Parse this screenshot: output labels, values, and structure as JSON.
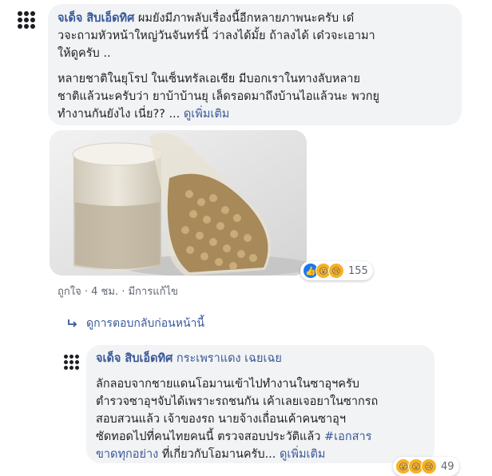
{
  "comment1": {
    "author": "จเด็จ สิบเอ็ดทิศ",
    "text1_line1": "ผมยังมีภาพลับเรื่องนี้อีกหลายภาพนะครับ เด๋",
    "text1_line2": "วจะถามหัวหน้าใหญ่วันจันทร์นี้ ว่าลงได้มั้ย ถ้าลงได้ เด๋วจะเอามา",
    "text1_line3": "ให้ดูครับ ..",
    "text2_line1": "หลายชาติในยุโรป ในเซ็นทรัลเอเชีย มีบอกเราในทางลับหลาย",
    "text2_line2": "ชาติแล้วนะครับว่า ยาบ้าบ้านยุ เล็ดรอดมาถึงบ้านไอแล้วนะ พวกยู",
    "text2_line3": "ทำงานกันยังไง เนี่ย??",
    "ellipsis": " ... ",
    "see_more": "ดูเพิ่มเติม",
    "reaction_count": "155",
    "like_label": "ถูกใจ",
    "time": "4 ชม.",
    "edited": "มีการแก้ไข",
    "sep": " · "
  },
  "view_previous_replies": "ดูการตอบกลับก่อนหน้านี้",
  "reply1": {
    "author": "จเด็จ สิบเอ็ดทิศ",
    "tag": "กระเพราแดง เฉยเฉย",
    "line1": "ลักลอบจากชายแดนโอมานเข้าไปทำงานในซาอุฯครับ",
    "line2": "ตำรวจซาอุฯจับได้เพราะรถชนกัน เค้าเลยเจอยาในซากรถ",
    "line3": "สอบสวนแล้ว เจ้าของรถ นายจ้างเถื่อนเค้าคนซาอุฯ",
    "line4_a": "ซัดทอดไปที่คนไทยคนนี้ ตรวจสอบประวัติแล้ว ",
    "hashtag": "#เอกสาร",
    "line5_a": "ขาดทุกอย่าง",
    "line5_b": " ที่เกี่ยวกับโอมานครับ... ",
    "see_more": "ดูเพิ่มเติม",
    "reaction_count": "49"
  },
  "icons": {
    "like": "👍",
    "wow": "😮",
    "sad": "😢"
  }
}
